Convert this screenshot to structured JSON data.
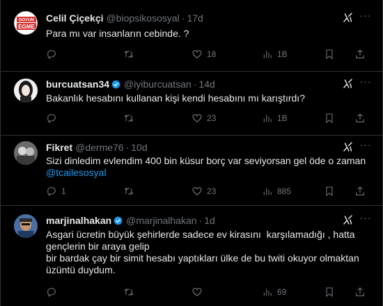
{
  "tweets": [
    {
      "name": "Celil Çiçekçi",
      "handle": "@biopsikososyal",
      "time": "17d",
      "avatar_text": [
        "DOYUN",
        "EGME"
      ],
      "text_lines": [
        "Para mı var insanların cebinde. ?"
      ],
      "reply_count": "",
      "retweet_count": "",
      "like_count": "18",
      "view_count": "1B"
    },
    {
      "name": "burcuatsan34",
      "handle": "@iyiburcuatsan",
      "time": "14d",
      "text_lines": [
        "Bakanlık hesabını kullanan kişi kendi hesabını mı karıştırdı?"
      ],
      "reply_count": "",
      "retweet_count": "",
      "like_count": "23",
      "view_count": "1B"
    },
    {
      "name": "Fikret",
      "handle": "@derme76",
      "time": "10d",
      "text_lines": [
        "Sizi dinledim evlendim 400 bin küsur borç var seviyorsan gel öde o zaman"
      ],
      "mention": "@tcailesosyal",
      "reply_count": "1",
      "retweet_count": "",
      "like_count": "23",
      "view_count": "885"
    },
    {
      "name": "marjinalhakan",
      "handle": "@marjinalhakan",
      "time": "1d",
      "text_lines": [
        "Asgari ücretin büyük şehirlerde sadece ev kirasını  karşılamadığı , hatta",
        "gençlerin bir araya gelip",
        "bir bardak çay bir simit hesabı yaptıkları ülke de bu twiti okuyor olmaktan",
        "üzüntü duydum."
      ],
      "reply_count": "",
      "retweet_count": "",
      "like_count": "",
      "view_count": "69"
    }
  ],
  "colors": {
    "background": "#000000",
    "text": "#e7e9ea",
    "muted": "#71767b",
    "link": "#1d9bf0",
    "divider": "#2f3336",
    "verified": "#1d9bf0"
  },
  "icons": [
    "grok-icon",
    "more-icon",
    "reply-icon",
    "retweet-icon",
    "like-icon",
    "views-icon",
    "bookmark-icon",
    "share-icon",
    "verified-badge-icon"
  ]
}
